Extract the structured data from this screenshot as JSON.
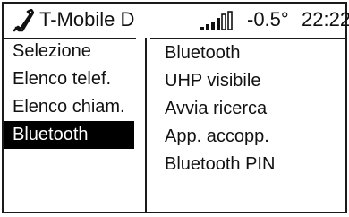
{
  "status_bar": {
    "network": "T-Mobile D",
    "temperature": "-0.5°",
    "time": "22:22",
    "icons": [
      "phone-icon",
      "signal-strength-icon"
    ]
  },
  "left_menu": {
    "items": [
      "Selezione",
      "Elenco telef.",
      "Elenco chiam.",
      "Bluetooth"
    ],
    "selected": "Bluetooth"
  },
  "right_menu": {
    "items": [
      "Bluetooth",
      "UHP visibile",
      "Avvia ricerca",
      "App. accopp.",
      "Bluetooth PIN"
    ]
  },
  "colors": {
    "background": "#ffffff",
    "border": "#1a1a1a",
    "highlight": "#000000",
    "highlight_text": "#ffffff"
  }
}
